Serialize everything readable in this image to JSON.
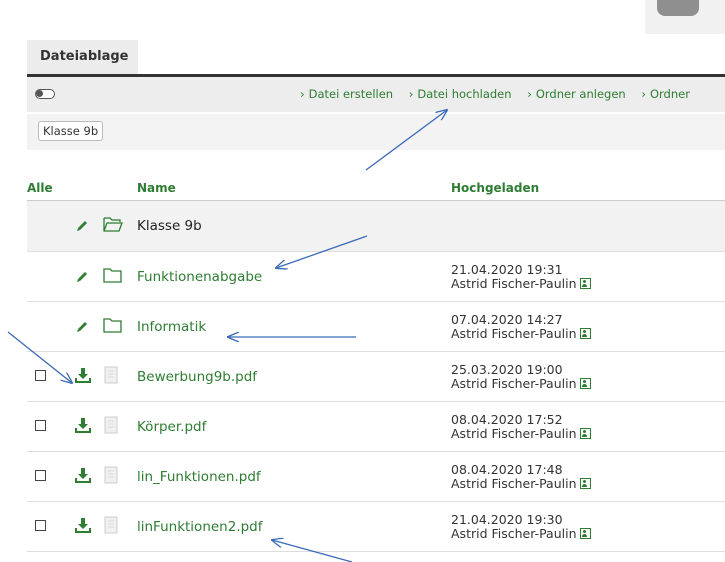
{
  "tab": {
    "label": "Dateiablage"
  },
  "toolbar": {
    "actions": [
      "Datei erstellen",
      "Datei hochladen",
      "Ordner anlegen",
      "Ordner"
    ]
  },
  "breadcrumb": {
    "label": "Klasse 9b"
  },
  "table": {
    "headers": {
      "all": "Alle",
      "name": "Name",
      "uploaded": "Hochgeladen"
    },
    "rows": [
      {
        "type": "current-folder",
        "name": "Klasse 9b",
        "date": "",
        "user": ""
      },
      {
        "type": "folder",
        "name": "Funktionenabgabe",
        "date": "21.04.2020 19:31",
        "user": "Astrid Fischer-Paulin"
      },
      {
        "type": "folder",
        "name": "Informatik",
        "date": "07.04.2020 14:27",
        "user": "Astrid Fischer-Paulin"
      },
      {
        "type": "file",
        "name": "Bewerbung9b.pdf",
        "date": "25.03.2020 19:00",
        "user": "Astrid Fischer-Paulin"
      },
      {
        "type": "file",
        "name": "Körper.pdf",
        "date": "08.04.2020 17:52",
        "user": "Astrid Fischer-Paulin"
      },
      {
        "type": "file",
        "name": "lin_Funktionen.pdf",
        "date": "08.04.2020 17:48",
        "user": "Astrid Fischer-Paulin"
      },
      {
        "type": "file",
        "name": "linFunktionen2.pdf",
        "date": "21.04.2020 19:30",
        "user": "Astrid Fischer-Paulin"
      }
    ]
  },
  "colors": {
    "accent": "#2e7d32",
    "annotation": "#3a6ab8"
  }
}
